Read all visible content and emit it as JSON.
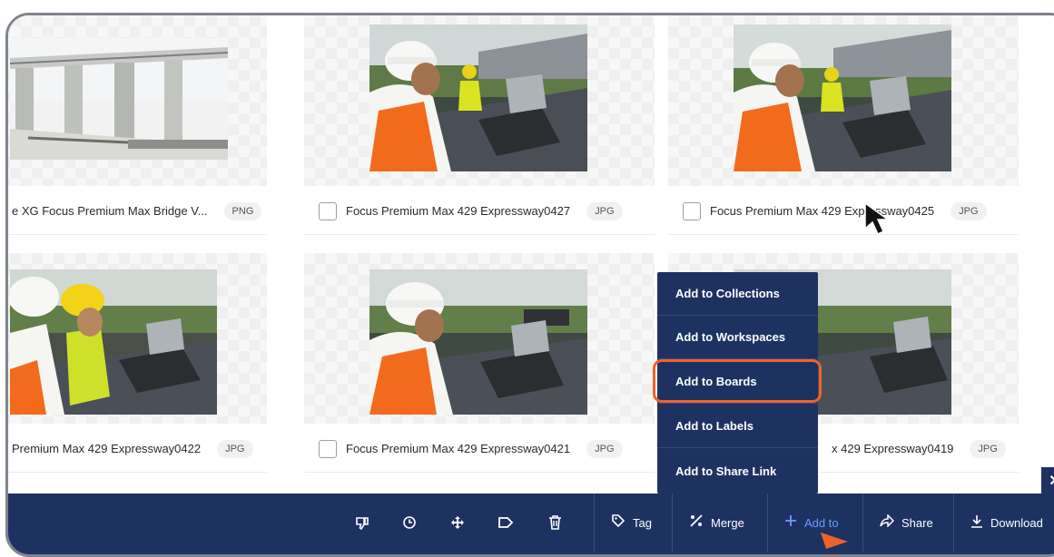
{
  "assets": [
    {
      "name": "e XG Focus Premium Max Bridge V...",
      "type": "PNG",
      "checkbox_visible": false
    },
    {
      "name": "Focus Premium Max 429 Expressway0427",
      "type": "JPG",
      "checkbox_visible": true
    },
    {
      "name": "Focus Premium Max 429 Expressway0425",
      "type": "JPG",
      "checkbox_visible": true
    },
    {
      "name": "Premium Max 429 Expressway0422",
      "type": "JPG",
      "checkbox_visible": false
    },
    {
      "name": "Focus Premium Max 429 Expressway0421",
      "type": "JPG",
      "checkbox_visible": true
    },
    {
      "name": "x 429 Expressway0419",
      "type": "JPG",
      "checkbox_visible": false
    }
  ],
  "menu": {
    "items": [
      {
        "label": "Add to Collections"
      },
      {
        "label": "Add to Workspaces"
      },
      {
        "label": "Add to Boards",
        "highlighted": true
      },
      {
        "label": "Add to Labels"
      },
      {
        "label": "Add to Share Link"
      }
    ]
  },
  "toolbar": {
    "icons": [
      "thumbs-down-icon",
      "clock-icon",
      "move-icon",
      "label-icon",
      "trash-icon"
    ],
    "buttons": [
      {
        "label": "Tag",
        "icon": "tag-icon"
      },
      {
        "label": "Merge",
        "icon": "merge-icon"
      },
      {
        "label": "Add to",
        "icon": "plus-icon",
        "active": true
      },
      {
        "label": "Share",
        "icon": "share-icon"
      },
      {
        "label": "Download",
        "icon": "download-icon"
      }
    ]
  },
  "close_label": "✕",
  "colors": {
    "toolbar_bg": "#1e3262",
    "highlight": "#f0622b",
    "active_text": "#6d9cff",
    "arrow": "#f0622b"
  }
}
